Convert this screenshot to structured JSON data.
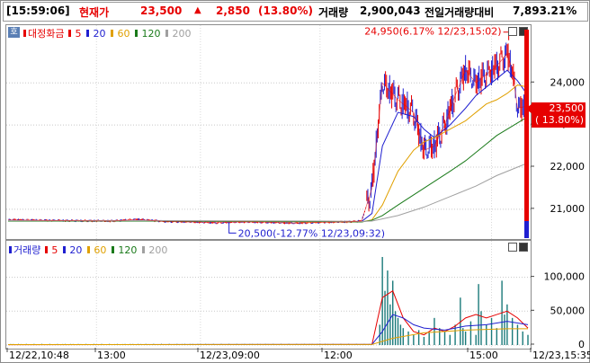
{
  "header": {
    "time": "[15:59:06]",
    "price_label": "현재가",
    "price": "23,500",
    "arrow": "▲",
    "change": "2,850",
    "change_pct": "(13.80%)",
    "volume_label": "거래량",
    "volume": "2,900,043",
    "prev_ratio_label": "전일거래량대비",
    "prev_ratio": "7,893.21%"
  },
  "colors": {
    "up": "#e60000",
    "ma5": "#e60000",
    "ma20": "#1f1fd0",
    "ma60": "#e0a000",
    "ma120": "#1a7a1a",
    "ma200": "#a0a0a0",
    "candle_up": "#e60000",
    "candle_down": "#1f1fd0",
    "price_tag": "#e60000",
    "volume_bar": "#1a7a7a"
  },
  "price_panel": {
    "tag_icon": "호",
    "legend_title": "대정화금",
    "legend_items": [
      {
        "label": "5",
        "color": "#e60000"
      },
      {
        "label": "20",
        "color": "#1f1fd0"
      },
      {
        "label": "60",
        "color": "#e0a000"
      },
      {
        "label": "120",
        "color": "#1a7a1a"
      },
      {
        "label": "200",
        "color": "#a0a0a0"
      }
    ],
    "high_annotation": "24,950(6.17% 12/23,15:02)",
    "low_annotation": "20,500(-12.77% 12/23,09:32)",
    "current_price_tag": "23,500",
    "current_pct_tag": "( 13.80%)"
  },
  "volume_panel": {
    "legend_title": "거래량",
    "legend_items": [
      {
        "label": "5",
        "color": "#e60000"
      },
      {
        "label": "20",
        "color": "#1f1fd0"
      },
      {
        "label": "60",
        "color": "#e0a000"
      },
      {
        "label": "120",
        "color": "#1a7a1a"
      },
      {
        "label": "200",
        "color": "#a0a0a0"
      }
    ]
  },
  "x_labels": [
    "12/22,10:48",
    "13:00",
    "12/23,09:00",
    "12:00",
    "15:00",
    "12/23,15:35"
  ],
  "chart_data": [
    {
      "type": "line",
      "title": "대정화금",
      "y_tick_labels": [
        "24,000",
        "23,000",
        "22,000",
        "21,000"
      ],
      "ylim": [
        20400,
        25200
      ],
      "x_range": [
        0,
        100
      ],
      "series": [
        {
          "name": "5",
          "x": [
            0,
            10,
            20,
            25,
            30,
            35,
            40,
            45,
            50,
            55,
            60,
            65,
            68,
            70,
            72,
            75,
            78,
            80,
            82,
            84,
            86,
            88,
            90,
            92,
            94,
            96,
            97,
            98,
            100
          ],
          "values": [
            20750,
            20730,
            20720,
            20760,
            20710,
            20700,
            20680,
            20700,
            20690,
            20670,
            20690,
            20700,
            20720,
            21500,
            24000,
            23600,
            23300,
            22400,
            22500,
            23000,
            23700,
            24300,
            24000,
            24200,
            24400,
            24700,
            24300,
            23400,
            23450
          ]
        },
        {
          "name": "20",
          "x": [
            0,
            30,
            60,
            66,
            68,
            70,
            72,
            75,
            78,
            80,
            82,
            85,
            88,
            90,
            92,
            94,
            96,
            98,
            100
          ],
          "values": [
            20730,
            20720,
            20700,
            20700,
            20710,
            20900,
            22500,
            23300,
            23200,
            22900,
            22700,
            23000,
            23400,
            23700,
            23900,
            24100,
            24300,
            24050,
            23700
          ]
        },
        {
          "name": "60",
          "x": [
            0,
            30,
            60,
            68,
            70,
            72,
            75,
            78,
            80,
            82,
            85,
            88,
            90,
            92,
            94,
            96,
            98,
            100
          ],
          "values": [
            20720,
            20720,
            20700,
            20700,
            20750,
            21100,
            21900,
            22400,
            22600,
            22700,
            22900,
            23100,
            23300,
            23500,
            23600,
            23750,
            23950,
            23900
          ]
        },
        {
          "name": "120",
          "x": [
            0,
            30,
            60,
            68,
            70,
            72,
            75,
            80,
            85,
            88,
            90,
            92,
            94,
            96,
            98,
            100
          ],
          "values": [
            20720,
            20720,
            20710,
            20700,
            20740,
            20850,
            21100,
            21500,
            21900,
            22150,
            22350,
            22550,
            22750,
            22900,
            23050,
            23200
          ]
        },
        {
          "name": "200",
          "x": [
            0,
            30,
            60,
            68,
            70,
            72,
            75,
            80,
            85,
            90,
            94,
            98,
            100
          ],
          "values": [
            20730,
            20730,
            20720,
            20710,
            20720,
            20770,
            20850,
            21050,
            21300,
            21550,
            21800,
            22000,
            22100
          ]
        }
      ],
      "high": {
        "value": 24950,
        "pct": 6.17,
        "time": "12/23,15:02"
      },
      "low": {
        "value": 20500,
        "pct": -12.77,
        "time": "12/23,09:32"
      },
      "current": 23500
    },
    {
      "type": "bar",
      "title": "거래량",
      "y_tick_labels": [
        "100,000",
        "50,000",
        "0"
      ],
      "ylim": [
        0,
        130000
      ],
      "x_range": [
        0,
        100
      ],
      "bars": [
        {
          "x": 71.5,
          "v": 30000
        },
        {
          "x": 72.0,
          "v": 130000
        },
        {
          "x": 72.5,
          "v": 80000
        },
        {
          "x": 73.0,
          "v": 110000
        },
        {
          "x": 73.5,
          "v": 60000
        },
        {
          "x": 74.0,
          "v": 95000
        },
        {
          "x": 74.5,
          "v": 50000
        },
        {
          "x": 75.0,
          "v": 40000
        },
        {
          "x": 75.5,
          "v": 30000
        },
        {
          "x": 76.0,
          "v": 25000
        },
        {
          "x": 77.0,
          "v": 20000
        },
        {
          "x": 78.0,
          "v": 15000
        },
        {
          "x": 79.0,
          "v": 22000
        },
        {
          "x": 80.0,
          "v": 12000
        },
        {
          "x": 81.0,
          "v": 18000
        },
        {
          "x": 82.0,
          "v": 40000
        },
        {
          "x": 83.0,
          "v": 25000
        },
        {
          "x": 84.0,
          "v": 20000
        },
        {
          "x": 85.0,
          "v": 15000
        },
        {
          "x": 86.0,
          "v": 30000
        },
        {
          "x": 87.0,
          "v": 70000
        },
        {
          "x": 87.5,
          "v": 25000
        },
        {
          "x": 88.0,
          "v": 20000
        },
        {
          "x": 89.0,
          "v": 35000
        },
        {
          "x": 90.0,
          "v": 15000
        },
        {
          "x": 90.5,
          "v": 90000
        },
        {
          "x": 91.0,
          "v": 50000
        },
        {
          "x": 92.0,
          "v": 30000
        },
        {
          "x": 93.0,
          "v": 40000
        },
        {
          "x": 94.0,
          "v": 25000
        },
        {
          "x": 95.0,
          "v": 95000
        },
        {
          "x": 95.5,
          "v": 45000
        },
        {
          "x": 96.0,
          "v": 60000
        },
        {
          "x": 97.0,
          "v": 40000
        },
        {
          "x": 98.0,
          "v": 30000
        },
        {
          "x": 99.0,
          "v": 20000
        },
        {
          "x": 100.0,
          "v": 15000
        }
      ],
      "series": [
        {
          "name": "5",
          "x": [
            0,
            70,
            72,
            74,
            76,
            78,
            80,
            82,
            84,
            86,
            88,
            90,
            92,
            94,
            96,
            98,
            100
          ],
          "values": [
            500,
            800,
            70000,
            80000,
            40000,
            20000,
            15000,
            25000,
            20000,
            28000,
            40000,
            45000,
            40000,
            45000,
            50000,
            40000,
            25000
          ]
        },
        {
          "name": "20",
          "x": [
            0,
            70,
            72,
            74,
            76,
            78,
            80,
            84,
            88,
            92,
            96,
            100
          ],
          "values": [
            600,
            900,
            20000,
            45000,
            40000,
            30000,
            25000,
            22000,
            28000,
            30000,
            35000,
            30000
          ]
        },
        {
          "name": "60",
          "x": [
            0,
            70,
            74,
            80,
            88,
            96,
            100
          ],
          "values": [
            600,
            900,
            10000,
            18000,
            22000,
            24000,
            24000
          ]
        }
      ]
    }
  ]
}
